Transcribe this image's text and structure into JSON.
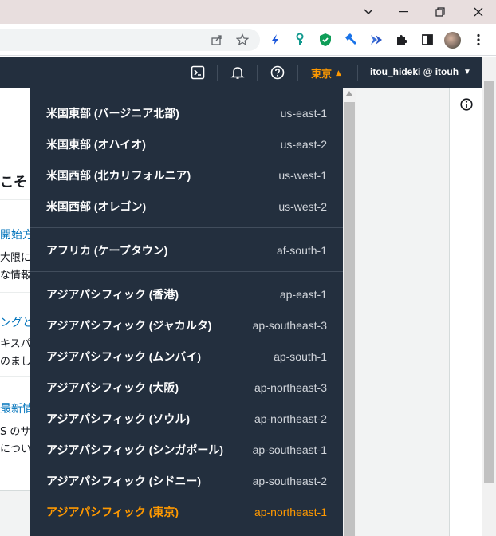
{
  "window_controls": {
    "minimize": "–",
    "restore": "❐",
    "close": "✕",
    "menu": "⌄"
  },
  "toolbar": {
    "icons": [
      "share-icon",
      "star-icon",
      "bolt-extension-icon",
      "key-extension-icon",
      "shield-extension-icon",
      "hammer-extension-icon",
      "arrows-extension-icon",
      "puzzle-icon",
      "sidepanel-icon",
      "profile-avatar",
      "kebab-menu-icon"
    ]
  },
  "aws_nav": {
    "region_label": "東京",
    "region_caret": "▲",
    "account_label": "itou_hideki @ itouh",
    "account_caret": "▼"
  },
  "background_page": {
    "title_fragment": "こそ",
    "sections": [
      {
        "link": "開始方法",
        "lines": [
          "大限に",
          "な情報を"
        ]
      },
      {
        "link": "ングと",
        "lines": [
          "キスパ",
          "のまし"
        ]
      },
      {
        "link": "最新情",
        "lines": [
          "S のサ",
          "につい"
        ]
      }
    ]
  },
  "region_menu": {
    "groups": [
      [
        {
          "name": "米国東部 (バージニア北部)",
          "code": "us-east-1"
        },
        {
          "name": "米国東部 (オハイオ)",
          "code": "us-east-2"
        },
        {
          "name": "米国西部 (北カリフォルニア)",
          "code": "us-west-1"
        },
        {
          "name": "米国西部 (オレゴン)",
          "code": "us-west-2"
        }
      ],
      [
        {
          "name": "アフリカ (ケープタウン)",
          "code": "af-south-1"
        }
      ],
      [
        {
          "name": "アジアパシフィック (香港)",
          "code": "ap-east-1"
        },
        {
          "name": "アジアパシフィック (ジャカルタ)",
          "code": "ap-southeast-3"
        },
        {
          "name": "アジアパシフィック (ムンバイ)",
          "code": "ap-south-1"
        },
        {
          "name": "アジアパシフィック (大阪)",
          "code": "ap-northeast-3"
        },
        {
          "name": "アジアパシフィック (ソウル)",
          "code": "ap-northeast-2"
        },
        {
          "name": "アジアパシフィック (シンガポール)",
          "code": "ap-southeast-1"
        },
        {
          "name": "アジアパシフィック (シドニー)",
          "code": "ap-southeast-2"
        },
        {
          "name": "アジアパシフィック (東京)",
          "code": "ap-northeast-1",
          "selected": true
        }
      ]
    ]
  },
  "colors": {
    "aws_nav_bg": "#232f3e",
    "accent_orange": "#ff9900",
    "link_blue": "#0073bb",
    "titlebar_bg": "#e8dede"
  }
}
